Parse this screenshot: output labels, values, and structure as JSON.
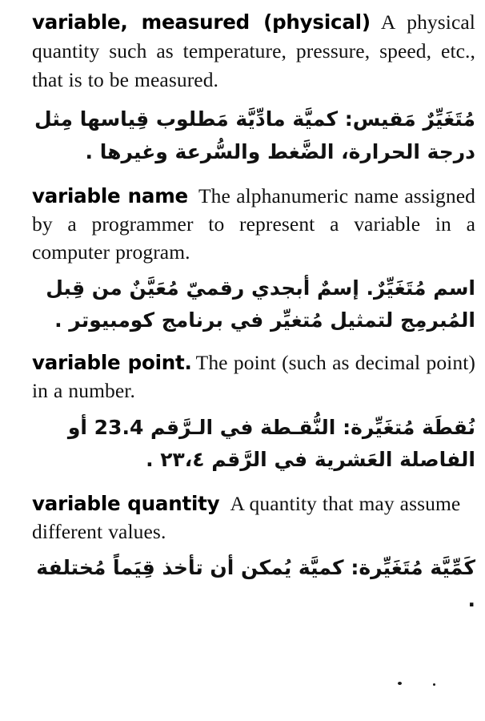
{
  "page": {
    "background_color": "#ffffff",
    "text_color": "#111111",
    "language_primary": "en",
    "language_secondary": "ar"
  },
  "entries": [
    {
      "id": "variable-measured",
      "headword": "variable, measured (physical)",
      "definition": "A physical quantity such as temperature, pressure, speed, etc., that is to be measured.",
      "arabic_term": "مُتَغَيِّرٌ مَقيس",
      "arabic_separator": ":",
      "arabic_definition": "كميَّة مادِّيَّة مَطلوب قِياسها مِثل درجة الحرارة، الضَّغط والسُّرعة وغيرها ."
    },
    {
      "id": "variable-name",
      "headword": "variable name",
      "definition": "The alphanumeric name assigned by a programmer to represent a variable in a computer program.",
      "arabic_term": "اسم مُتَغَيِّرٌ",
      "arabic_separator": ".",
      "arabic_definition": "إسمٌ أبجدي رقميّ مُعَيَّنٌ من قِبل المُبرمِج لتمثيل مُتغيِّر في برنامج كومبيوتر ."
    },
    {
      "id": "variable-point",
      "headword": "variable point.",
      "definition": "The point (such as decimal point) in a number.",
      "arabic_term": "نُقطَة مُتغَيِّرة",
      "arabic_separator": ":",
      "arabic_definition": "النُّقـطة في الـرَّقم 23.4 أو الفاصلة العَشرية في الرَّقم ٢٣،٤ .",
      "numbers_shown": [
        "23.4",
        "٢٣،٤"
      ]
    },
    {
      "id": "variable-quantity",
      "headword": "variable quantity",
      "definition": "A quantity that may assume different values.",
      "arabic_term": "كَمِّيَّة مُتَغَيِّرة",
      "arabic_separator": ":",
      "arabic_definition": "كميَّة يُمكن أن تأخذ قِيَماً مُختلفة ."
    }
  ]
}
